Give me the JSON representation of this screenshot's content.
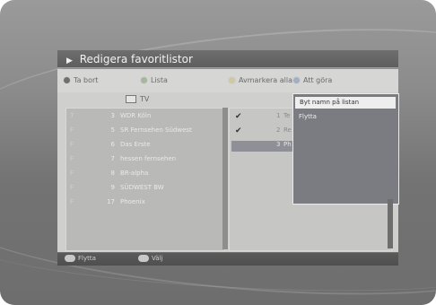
{
  "screen": {
    "title": "Redigera favoritlistor",
    "colors": {
      "frame": "#8b8b8b",
      "panel": "#cfcfcd",
      "popup": "#7b7c82",
      "selection": "#8f8f97"
    }
  },
  "toolbar": {
    "delete_label": "Ta bort",
    "list_label": "Lista",
    "deselect_all_label": "Avmarkera alla",
    "edit_label": "Att göra"
  },
  "list_header": {
    "label": "TV"
  },
  "channels_left": [
    {
      "index": "7",
      "number": "3",
      "name": "WDR Köln"
    },
    {
      "index": "F",
      "number": "5",
      "name": "SR Fernsehen Südwest"
    },
    {
      "index": "F",
      "number": "6",
      "name": "Das Erste"
    },
    {
      "index": "F",
      "number": "7",
      "name": "hessen fernsehen"
    },
    {
      "index": "F",
      "number": "8",
      "name": "BR-alpha"
    },
    {
      "index": "F",
      "number": "9",
      "name": "SÜDWEST BW"
    },
    {
      "index": "F",
      "number": "17",
      "name": "Phoenix"
    }
  ],
  "channels_right": [
    {
      "checked": true,
      "number": "1",
      "name": "Te"
    },
    {
      "checked": true,
      "number": "2",
      "name": "Re"
    },
    {
      "checked": false,
      "number": "3",
      "name": "Ph"
    }
  ],
  "popup": {
    "items": [
      "Byt namn på listan",
      "Flytta"
    ]
  },
  "bottombar": {
    "move_label": "Flytta",
    "ok_label": "Välj"
  }
}
